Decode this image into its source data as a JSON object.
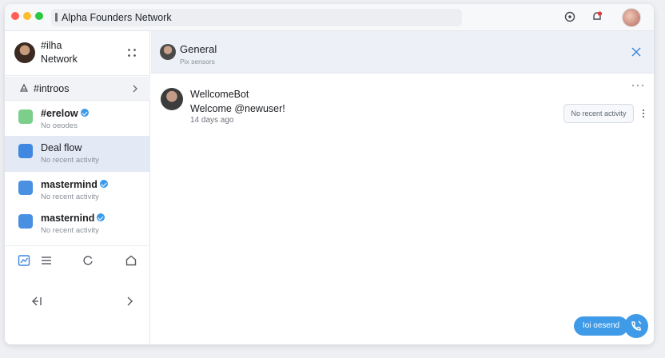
{
  "window": {
    "address_title": "Alpha Founders Network"
  },
  "workspace": {
    "name_line1": "#ilha",
    "name_line2": "Network"
  },
  "channel": {
    "label": "#introos"
  },
  "rooms": [
    {
      "name": "#erelow",
      "subtitle": "No oeodes",
      "verified": true,
      "icon_color": "#7ccf8a",
      "active": false
    },
    {
      "name": "Deal flow",
      "subtitle": "No recent activity",
      "verified": false,
      "icon_color": "#3f87e0",
      "active": true
    },
    {
      "name": "mastermind",
      "subtitle": "No recent activity",
      "verified": true,
      "icon_color": "#4a90e2",
      "active": false
    },
    {
      "name": "masternind",
      "subtitle": "No recent activity",
      "verified": true,
      "icon_color": "#4a90e2",
      "active": false
    }
  ],
  "main": {
    "header_title": "General",
    "header_subtitle": "Pix sensors"
  },
  "message": {
    "author": "WellcomeBot",
    "text": "Welcome @newuser!",
    "time": "14 days ago"
  },
  "activity": {
    "label": "No recent activity"
  },
  "fab": {
    "label": "Ioi oesend"
  },
  "colors": {
    "accent": "#3f9be8",
    "active_row": "#e3eaf6",
    "header_bg": "#edf1f7"
  }
}
